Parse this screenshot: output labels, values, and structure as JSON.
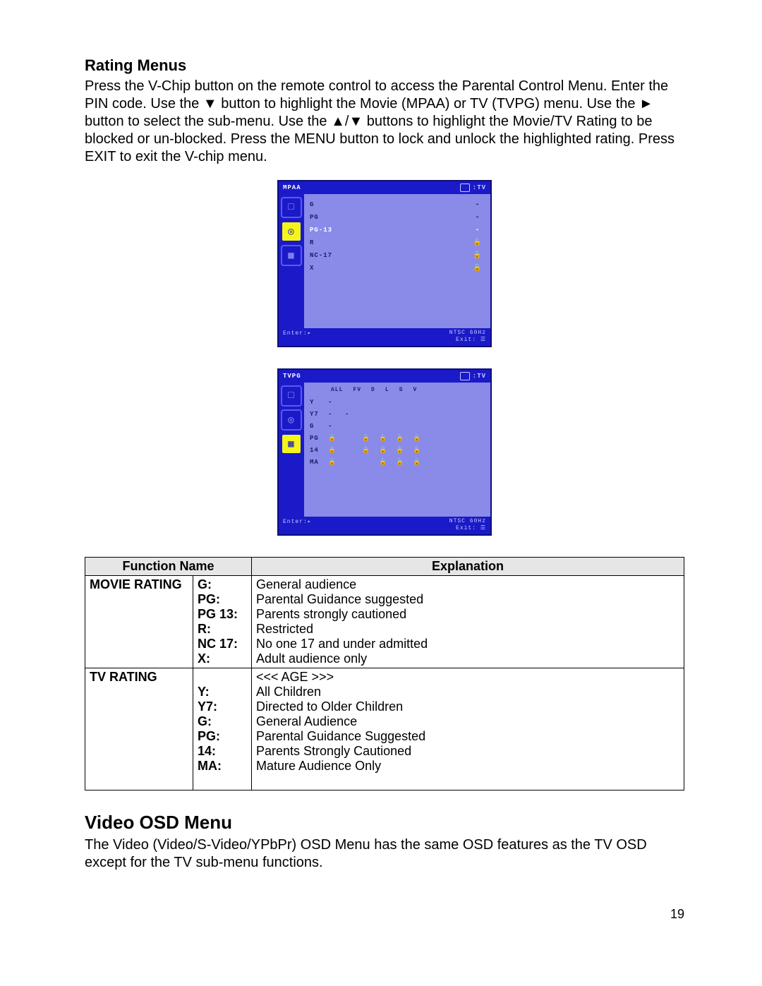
{
  "heading1": "Rating Menus",
  "para1": "Press the V-Chip button on the remote control to access the Parental Control Menu. Enter the PIN code. Use the ▼ button to highlight the Movie (MPAA) or TV (TVPG) menu. Use the ► button to select the sub-menu. Use the ▲/▼ buttons to highlight the Movie/TV Rating to be blocked or un-blocked. Press the MENU button to lock and unlock the highlighted rating. Press EXIT to exit the V-chip menu.",
  "osd1": {
    "title": "MPAA",
    "tv_label": ":TV",
    "rows": [
      {
        "label": "G",
        "val": "-",
        "sel": false
      },
      {
        "label": "PG",
        "val": "-",
        "sel": false
      },
      {
        "label": "PG-13",
        "val": "-",
        "sel": true
      },
      {
        "label": "R",
        "val": "🔒",
        "sel": false
      },
      {
        "label": "NC-17",
        "val": "🔒",
        "sel": false
      },
      {
        "label": "X",
        "val": "🔒",
        "sel": false
      }
    ],
    "status": "NTSC 60Hz",
    "enter": "Enter:▸",
    "exit": "Exit: ☰"
  },
  "osd2": {
    "title": "TVPG",
    "tv_label": ":TV",
    "cols": [
      "ALL",
      "FV",
      "D",
      "L",
      "S",
      "V"
    ],
    "rows": [
      {
        "label": "Y",
        "cells": [
          "-",
          "",
          "",
          "",
          "",
          ""
        ]
      },
      {
        "label": "Y7",
        "cells": [
          "-",
          "-",
          "",
          "",
          "",
          ""
        ]
      },
      {
        "label": "G",
        "cells": [
          "-",
          "",
          "",
          "",
          "",
          ""
        ]
      },
      {
        "label": "PG",
        "cells": [
          "🔒",
          "",
          "🔒",
          "🔒",
          "🔒",
          "🔒"
        ]
      },
      {
        "label": "14",
        "cells": [
          "🔒",
          "",
          "🔒",
          "🔒",
          "🔒",
          "🔒"
        ]
      },
      {
        "label": "MA",
        "cells": [
          "🔒",
          "",
          "",
          "🔒",
          "🔒",
          "🔒"
        ]
      }
    ],
    "status": "NTSC 60Hz",
    "enter": "Enter:▸",
    "exit": "Exit: ☰"
  },
  "table": {
    "head_fn": "Function Name",
    "head_ex": "Explanation",
    "movie_label": "MOVIE RATING",
    "movie_rows": [
      {
        "code": "G:",
        "desc": "General audience"
      },
      {
        "code": "PG:",
        "desc": "Parental Guidance suggested"
      },
      {
        "code": "PG 13:",
        "desc": "Parents strongly cautioned"
      },
      {
        "code": "R:",
        "desc": "Restricted"
      },
      {
        "code": "NC 17:",
        "desc": "No one 17 and under admitted"
      },
      {
        "code": "X:",
        "desc": "Adult audience only"
      }
    ],
    "tv_label": "TV RATING",
    "tv_age_header": "<<< AGE >>>",
    "tv_rows": [
      {
        "code": "Y:",
        "desc": "All Children"
      },
      {
        "code": "Y7:",
        "desc": "Directed to Older Children"
      },
      {
        "code": "G:",
        "desc": "General Audience"
      },
      {
        "code": "PG:",
        "desc": "Parental Guidance Suggested"
      },
      {
        "code": "14:",
        "desc": "Parents Strongly Cautioned"
      },
      {
        "code": "MA:",
        "desc": "Mature Audience Only"
      }
    ]
  },
  "heading2": "Video OSD Menu",
  "para2": "The Video (Video/S-Video/YPbPr) OSD Menu has the same OSD features as the TV OSD except for the TV sub-menu functions.",
  "page_number": "19"
}
